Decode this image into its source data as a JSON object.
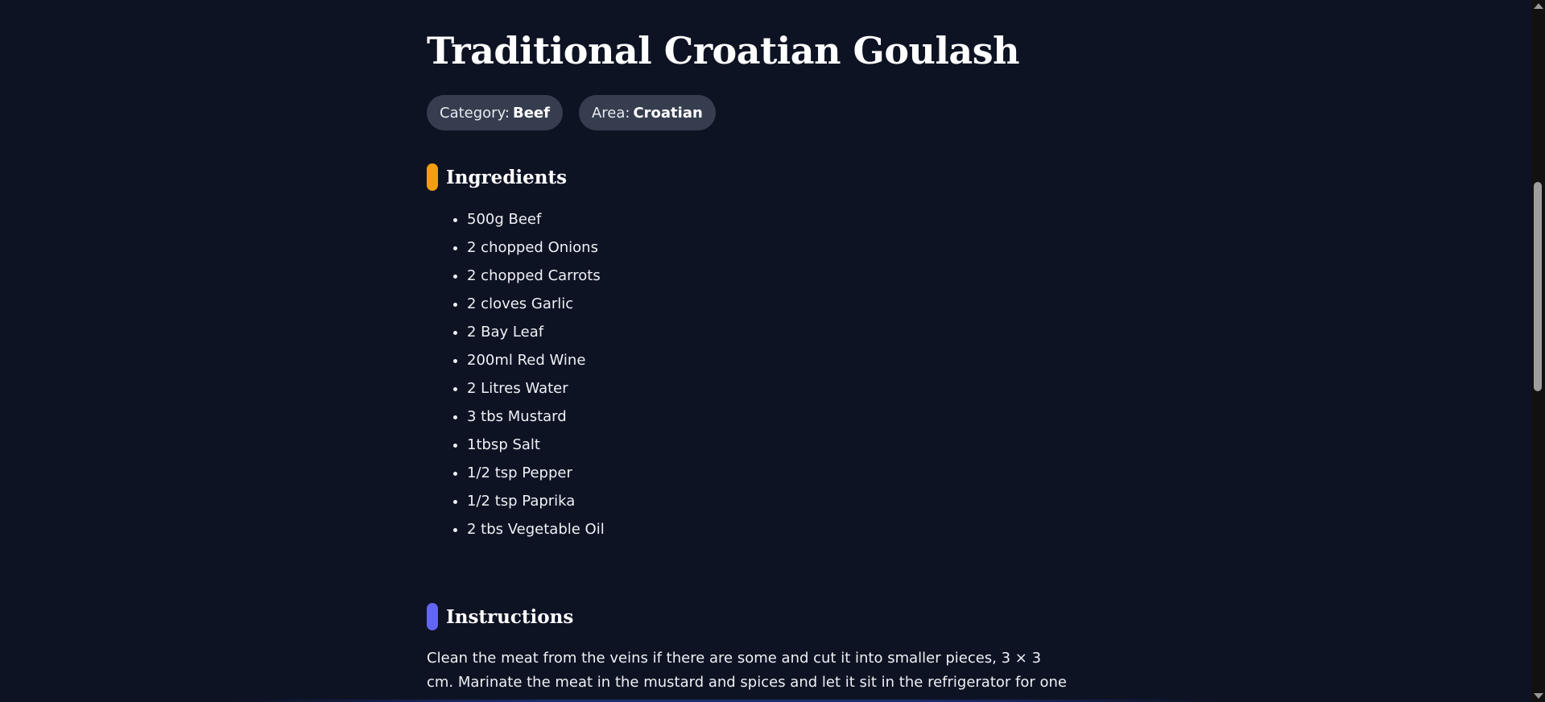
{
  "recipe": {
    "title": "Traditional Croatian Goulash",
    "category_label": "Category:",
    "category_value": "Beef",
    "area_label": "Area:",
    "area_value": "Croatian"
  },
  "ingredients": {
    "heading": "Ingredients",
    "accent_color": "#f59e0b",
    "items": [
      "500g Beef",
      "2 chopped Onions",
      "2 chopped Carrots",
      "2 cloves Garlic",
      "2 Bay Leaf",
      "200ml Red Wine",
      "2 Litres Water",
      "3 tbs Mustard",
      "1tbsp Salt",
      "1/2 tsp Pepper",
      "1/2 tsp Paprika",
      "2 tbs Vegetable Oil"
    ]
  },
  "instructions": {
    "heading": "Instructions",
    "accent_color": "#6366f1",
    "text": "Clean the meat from the veins if there are some and cut it into smaller pieces, 3 × 3 cm. Marinate the meat in the mustard and spices and let it sit in the refrigerator for one hour"
  },
  "theme": {
    "background": "#0e1324",
    "badge_background": "#353d4f"
  }
}
